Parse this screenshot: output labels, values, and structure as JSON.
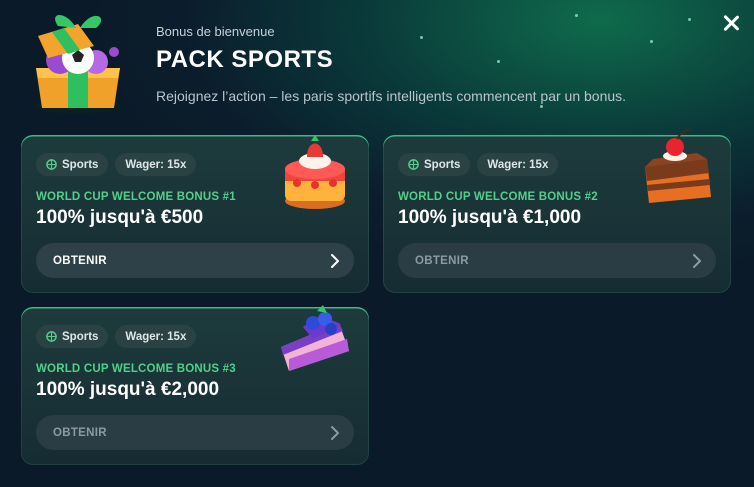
{
  "header": {
    "subtitle": "Bonus de bienvenue",
    "title": "PACK SPORTS",
    "tagline": "Rejoignez l’action – les paris sportifs intelligents commencent par un bonus."
  },
  "cards": [
    {
      "tags": [
        "Sports",
        "Wager: 15x"
      ],
      "title": "WORLD CUP WELCOME BONUS #1",
      "amount": "100% jusqu'à €500",
      "button": "OBTENIR",
      "icon": "strawberry-cake-icon"
    },
    {
      "tags": [
        "Sports",
        "Wager: 15x"
      ],
      "title": "WORLD CUP WELCOME BONUS #2",
      "amount": "100% jusqu'à €1,000",
      "button": "OBTENIR",
      "icon": "cherry-cake-icon"
    },
    {
      "tags": [
        "Sports",
        "Wager: 15x"
      ],
      "title": "WORLD CUP WELCOME BONUS #3",
      "amount": "100% jusqu'à €2,000",
      "button": "OBTENIR",
      "icon": "blueberry-cake-icon"
    }
  ],
  "colors": {
    "accent_green": "#52d08a",
    "background": "#0b1a28",
    "card": "#1d3b3c"
  }
}
